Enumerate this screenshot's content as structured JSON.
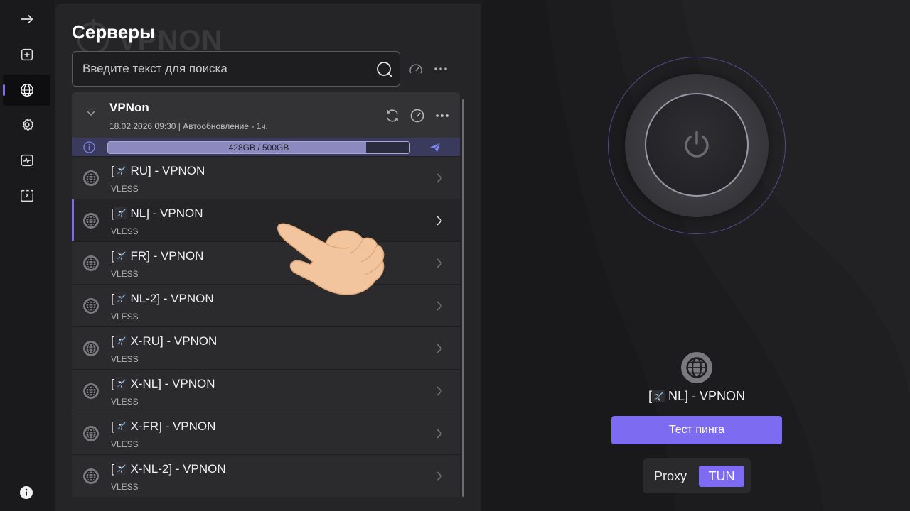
{
  "page": {
    "title": "Серверы",
    "watermark_text": "VPNON"
  },
  "search": {
    "placeholder": "Введите текст для поиска",
    "value": ""
  },
  "group": {
    "name": "VPNon",
    "subtitle": "18.02.2026 09:30 | Автообновление - 1ч.",
    "usage_label": "428GB / 500GB",
    "usage_fraction": 0.856
  },
  "servers": [
    {
      "name_suffix": "RU] - VPNON",
      "type": "VLESS"
    },
    {
      "name_suffix": "NL] - VPNON",
      "type": "VLESS",
      "active": true
    },
    {
      "name_suffix": "FR] - VPNON",
      "type": "VLESS"
    },
    {
      "name_suffix": "NL-2] - VPNON",
      "type": "VLESS"
    },
    {
      "name_suffix": "X-RU] - VPNON",
      "type": "VLESS"
    },
    {
      "name_suffix": "X-NL] - VPNON",
      "type": "VLESS"
    },
    {
      "name_suffix": "X-FR] - VPNON",
      "type": "VLESS"
    },
    {
      "name_suffix": "X-NL-2] - VPNON",
      "type": "VLESS"
    }
  ],
  "current": {
    "name_suffix": "NL] - VPNON",
    "ping_label": "Тест пинга"
  },
  "mode": {
    "proxy_label": "Proxy",
    "tun_label": "TUN",
    "selected": "TUN"
  },
  "colors": {
    "accent": "#7d6bf1",
    "usage_fill": "#8c89bf",
    "usage_row": "#3a3a5c"
  }
}
